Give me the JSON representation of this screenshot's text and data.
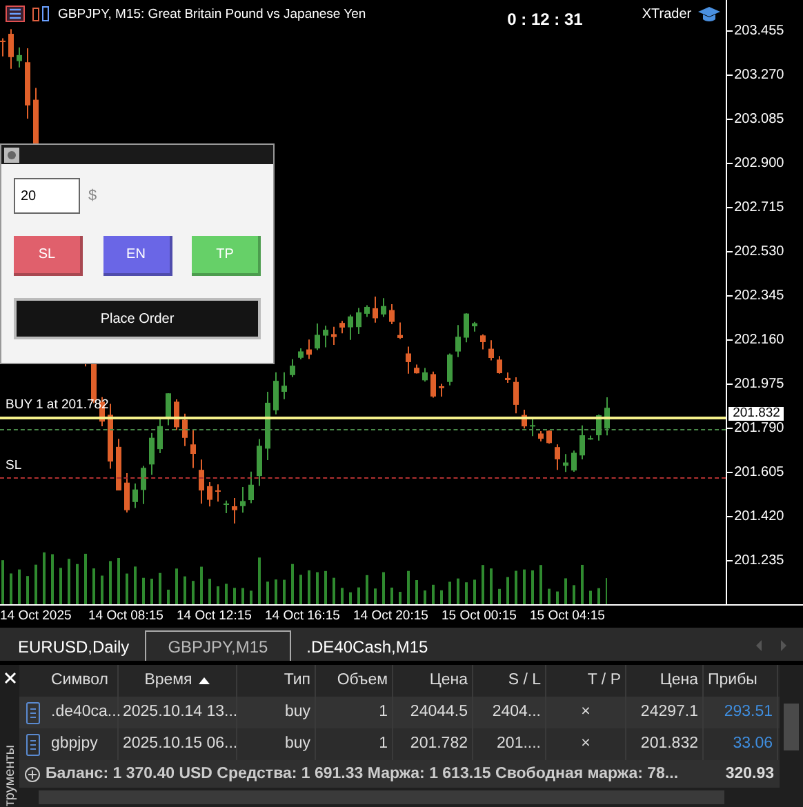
{
  "header": {
    "title": "GBPJPY, M15:  Great Britain Pound vs Japanese Yen",
    "timer": "0 : 12 : 31",
    "brand": "XTrader"
  },
  "chart": {
    "price_ticks": [
      "203.455",
      "203.270",
      "203.085",
      "202.900",
      "202.715",
      "202.530",
      "202.345",
      "202.160",
      "201.975",
      "201.790",
      "201.605",
      "201.420",
      "201.235"
    ],
    "time_ticks": [
      "14 Oct 2025",
      "14 Oct 08:15",
      "14 Oct 12:15",
      "14 Oct 16:15",
      "14 Oct 20:15",
      "15 Oct 00:15",
      "15 Oct 04:15"
    ],
    "lines": [
      {
        "kind": "bid",
        "label": "BUY 1 at 201.782"
      },
      {
        "kind": "entry"
      },
      {
        "kind": "sl",
        "label": "SL"
      }
    ],
    "bid_label": "201.832"
  },
  "order_panel": {
    "amount": "20",
    "currency": "$",
    "buttons": [
      {
        "kind": "sl",
        "label": "SL"
      },
      {
        "kind": "en",
        "label": "EN"
      },
      {
        "kind": "tp",
        "label": "TP"
      }
    ],
    "submit": "Place Order"
  },
  "tabs": [
    {
      "label": "EURUSD,Daily",
      "selected": false
    },
    {
      "label": "GBPJPY,M15",
      "selected": true
    },
    {
      "label": ".DE40Cash,M15",
      "selected": false
    }
  ],
  "side_label": "трументы",
  "positions": {
    "columns": [
      {
        "label": "Символ"
      },
      {
        "label": "Время",
        "sorted": true
      },
      {
        "label": "Тип"
      },
      {
        "label": "Объем"
      },
      {
        "label": "Цена"
      },
      {
        "label": "S / L"
      },
      {
        "label": "T / P"
      },
      {
        "label": "Цена"
      },
      {
        "label": "Прибы"
      }
    ],
    "rows": [
      {
        "symbol": ".de40ca...",
        "time": "2025.10.14 13...",
        "type": "buy",
        "volume": "1",
        "price": "24044.5",
        "sl": "2404...",
        "tp_close": "×",
        "current": "24297.1",
        "profit": "293.51"
      },
      {
        "symbol": "gbpjpy",
        "time": "2025.10.15 06...",
        "type": "buy",
        "volume": "1",
        "price": "201.782",
        "sl": "201....",
        "tp_close": "×",
        "current": "201.832",
        "profit": "33.06"
      }
    ],
    "summary": "Баланс: 1 370.40 USD  Средства: 1 691.33  Маржа: 1 613.15  Свободная маржа: 78...",
    "total": "320.93"
  }
}
